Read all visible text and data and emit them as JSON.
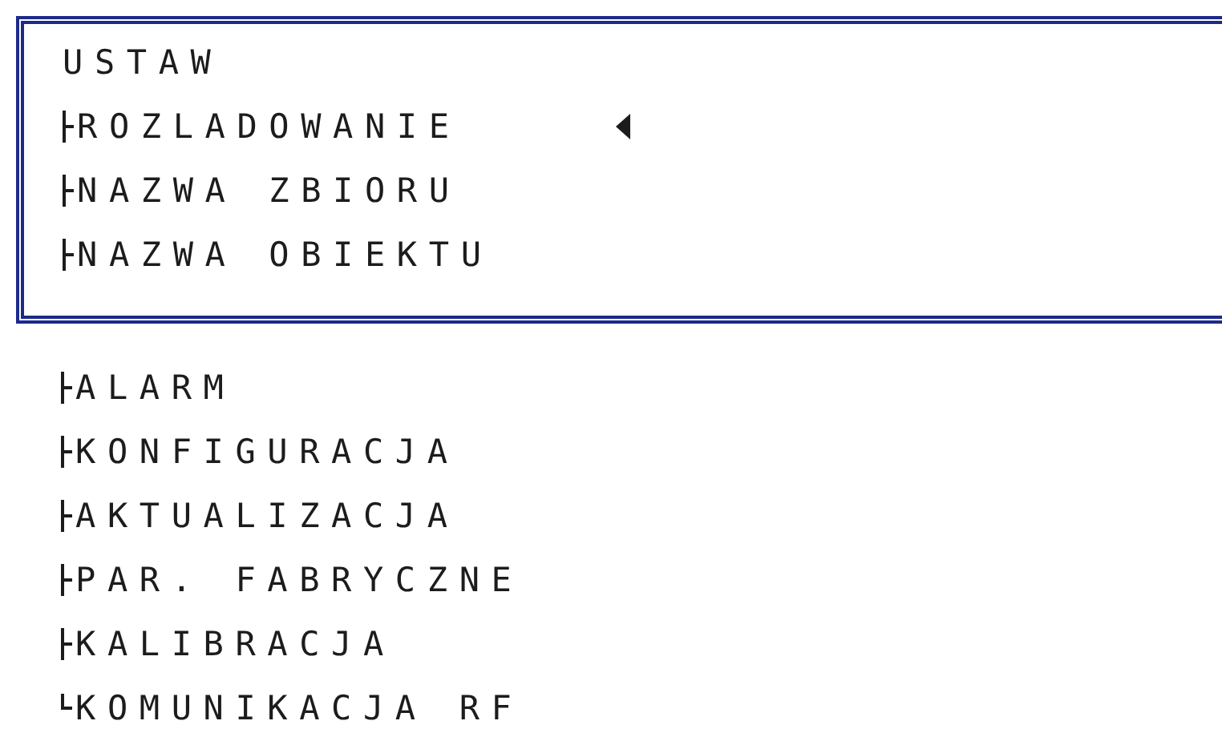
{
  "frame": {
    "title": "USTAW",
    "items": [
      {
        "label": "ROZLADOWANIE",
        "kind": "branch",
        "selected": true
      },
      {
        "label": "NAZWA ZBIORU",
        "kind": "branch",
        "selected": false
      },
      {
        "label": "NAZWA OBIEKTU",
        "kind": "branch",
        "selected": false
      }
    ]
  },
  "items_below": [
    {
      "label": "ALARM",
      "kind": "branch",
      "selected": false
    },
    {
      "label": "KONFIGURACJA",
      "kind": "branch",
      "selected": false
    },
    {
      "label": "AKTUALIZACJA",
      "kind": "branch",
      "selected": false
    },
    {
      "label": "PAR. FABRYCZNE",
      "kind": "branch",
      "selected": false
    },
    {
      "label": "KALIBRACJA",
      "kind": "branch",
      "selected": false
    },
    {
      "label": "KOMUNIKACJA RF",
      "kind": "last",
      "selected": false
    }
  ]
}
